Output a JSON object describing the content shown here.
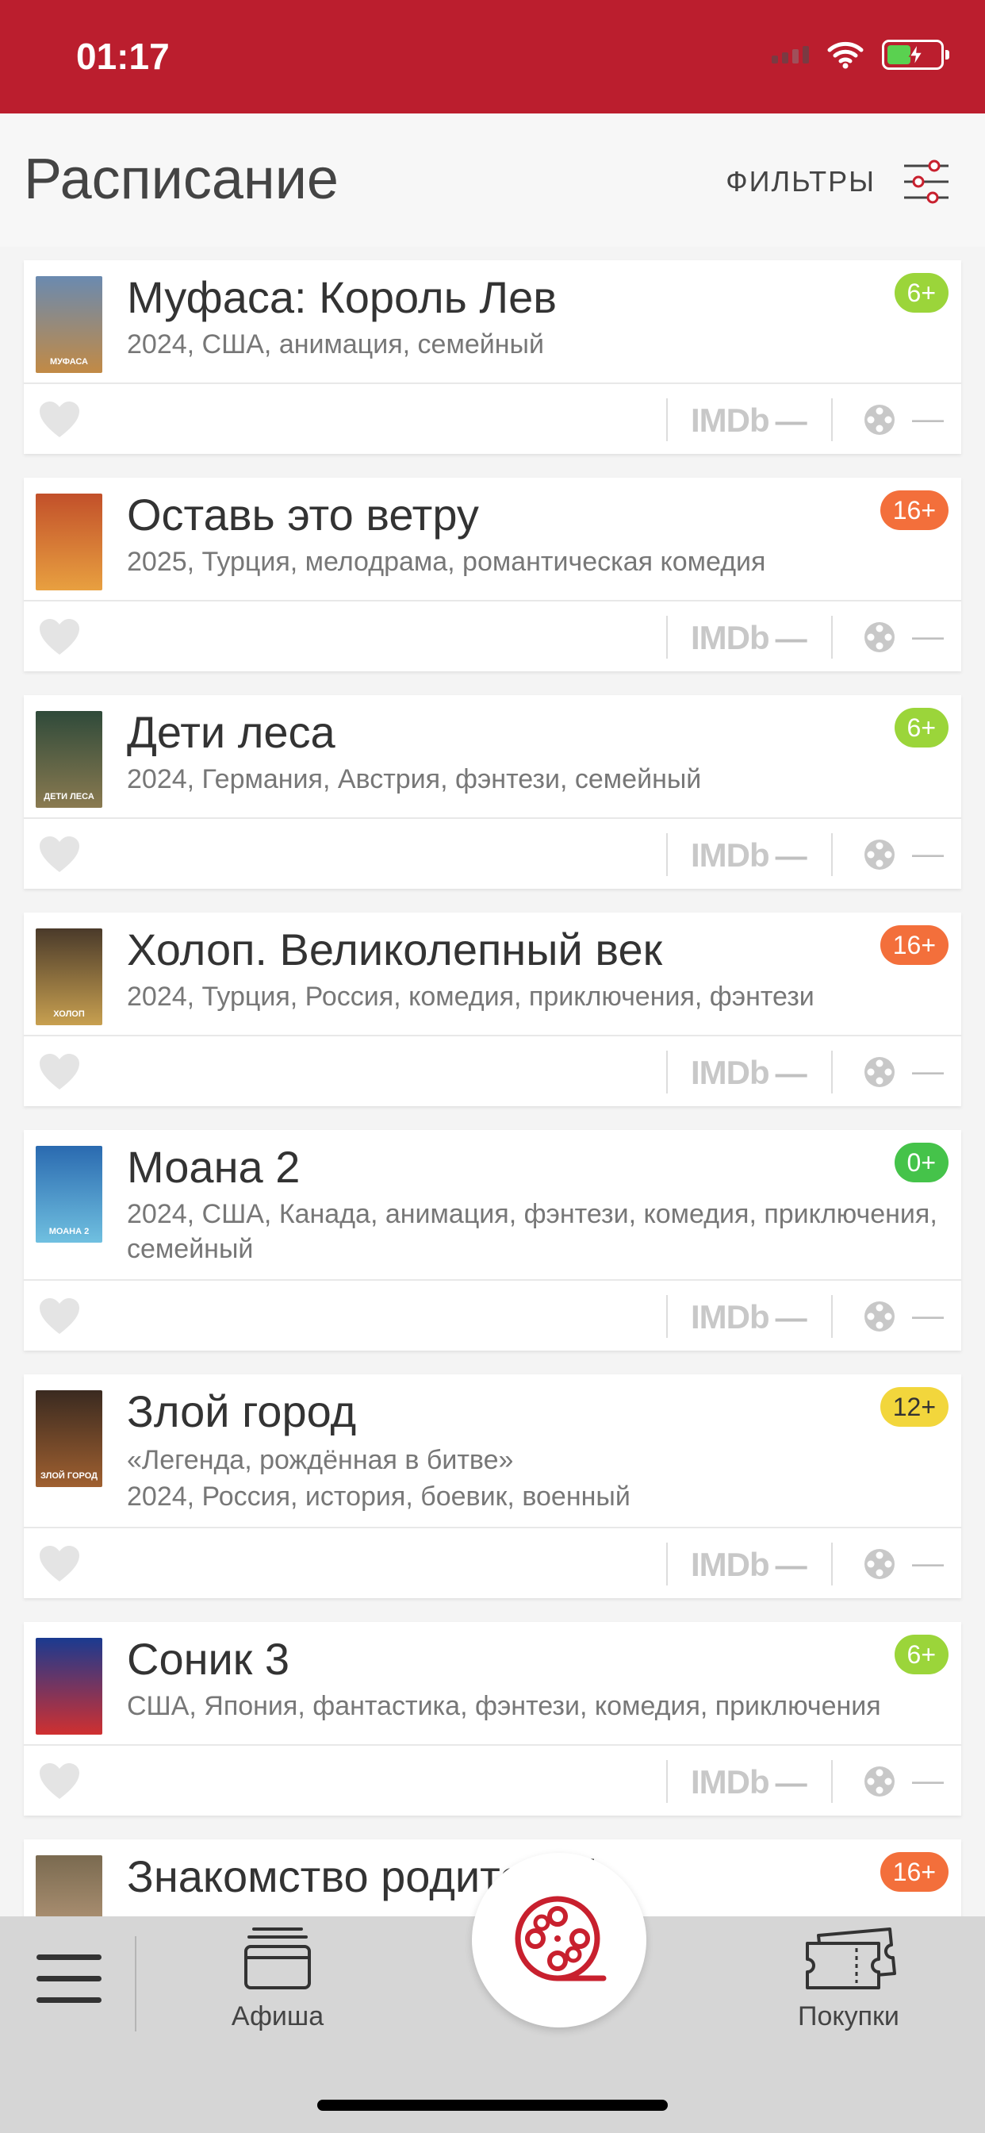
{
  "status_bar": {
    "time": "01:17"
  },
  "header": {
    "title": "Расписание",
    "filters_label": "ФИЛЬТРЫ"
  },
  "movies": [
    {
      "title": "Муфаса: Король Лев",
      "subtitle": "",
      "meta": "2024, США, анимация, семейный",
      "age": "6+",
      "age_color": "#9bd53a",
      "poster_colors": [
        "#6a8ab0",
        "#c28a45"
      ],
      "poster_text": "МУФАСА",
      "imdb": "IMDb",
      "imdb_value": "—",
      "kp_value": "—"
    },
    {
      "title": "Оставь это ветру",
      "subtitle": "",
      "meta": "2025, Турция, мелодрама, романтическая комедия",
      "age": "16+",
      "age_color": "#f36f3b",
      "poster_colors": [
        "#c2502a",
        "#e8a040"
      ],
      "poster_text": "",
      "imdb": "IMDb",
      "imdb_value": "—",
      "kp_value": "—"
    },
    {
      "title": "Дети леса",
      "subtitle": "",
      "meta": "2024, Германия, Австрия, фэнтези, семейный",
      "age": "6+",
      "age_color": "#9bd53a",
      "poster_colors": [
        "#2f4a3a",
        "#8a7a50"
      ],
      "poster_text": "ДЕТИ ЛЕСА",
      "imdb": "IMDb",
      "imdb_value": "—",
      "kp_value": "—"
    },
    {
      "title": "Холоп. Великолепный век",
      "subtitle": "",
      "meta": "2024, Турция, Россия, комедия, приключения, фэнтези",
      "age": "16+",
      "age_color": "#f36f3b",
      "poster_colors": [
        "#4a3a2a",
        "#c8a050"
      ],
      "poster_text": "ХОЛОП",
      "imdb": "IMDb",
      "imdb_value": "—",
      "kp_value": "—"
    },
    {
      "title": "Моана 2",
      "subtitle": "",
      "meta": "2024, США, Канада, анимация, фэнтези, комедия, приключения, семейный",
      "age": "0+",
      "age_color": "#45c34a",
      "poster_colors": [
        "#2a6ab0",
        "#70c0e0"
      ],
      "poster_text": "МОАНА 2",
      "imdb": "IMDb",
      "imdb_value": "—",
      "kp_value": "—"
    },
    {
      "title": "Злой город",
      "subtitle": "«Легенда, рождённая в битве»",
      "meta": "2024, Россия, история, боевик, военный",
      "age": "12+",
      "age_color": "#f2d63c",
      "poster_colors": [
        "#3a2a20",
        "#a06030"
      ],
      "poster_text": "ЗЛОЙ ГОРОД",
      "imdb": "IMDb",
      "imdb_value": "—",
      "kp_value": "—"
    },
    {
      "title": "Соник 3",
      "subtitle": "",
      "meta": "США, Япония, фантастика, фэнтези, комедия, приключения",
      "age": "6+",
      "age_color": "#9bd53a",
      "poster_colors": [
        "#1a3a90",
        "#d03030"
      ],
      "poster_text": "",
      "imdb": "IMDb",
      "imdb_value": "—",
      "kp_value": "—"
    },
    {
      "title": "Знакомство родителей",
      "subtitle": "",
      "meta": "",
      "age": "16+",
      "age_color": "#f36f3b",
      "poster_colors": [
        "#7a6a50",
        "#c0a080"
      ],
      "poster_text": "",
      "imdb": "IMDb",
      "imdb_value": "—",
      "kp_value": "—"
    }
  ],
  "tab_bar": {
    "afisha_label": "Афиша",
    "purchases_label": "Покупки"
  },
  "colors": {
    "brand": "#bb1e2e",
    "accent_red": "#c8202e"
  }
}
